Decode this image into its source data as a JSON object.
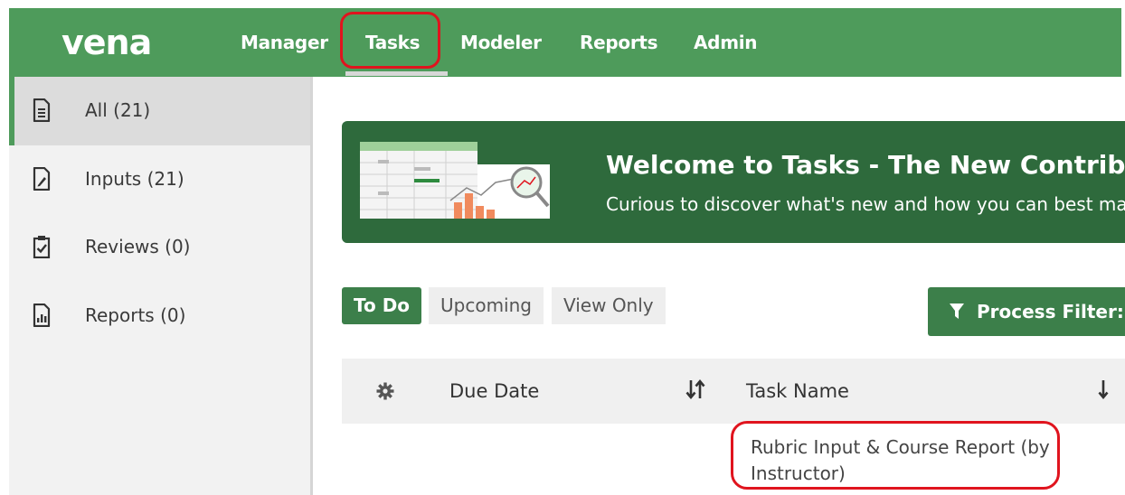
{
  "app": {
    "logo_text": "vena",
    "brand_color": "#4e9b5b",
    "dark_green": "#2e6a3c",
    "highlight_color": "#e0141e"
  },
  "nav": {
    "items": [
      {
        "label": "Manager"
      },
      {
        "label": "Tasks",
        "active": true
      },
      {
        "label": "Modeler"
      },
      {
        "label": "Reports"
      },
      {
        "label": "Admin"
      }
    ]
  },
  "sidebar": {
    "items": [
      {
        "label": "All (21)",
        "icon": "document-icon",
        "active": true
      },
      {
        "label": "Inputs (21)",
        "icon": "edit-document-icon"
      },
      {
        "label": "Reviews (0)",
        "icon": "clipboard-check-icon"
      },
      {
        "label": "Reports (0)",
        "icon": "report-chart-icon"
      }
    ]
  },
  "banner": {
    "title": "Welcome to Tasks - The New Contributo",
    "subtitle": "Curious to discover what's new and how you can best mar"
  },
  "tabs": [
    {
      "label": "To Do",
      "active": true
    },
    {
      "label": "Upcoming"
    },
    {
      "label": "View Only"
    }
  ],
  "filter": {
    "label": "Process Filter: A",
    "icon": "filter-icon"
  },
  "table": {
    "columns": [
      {
        "label": "Due Date",
        "sort_icon": "sort-updown-icon"
      },
      {
        "label": "Task Name",
        "sort_icon": "sort-down-icon"
      }
    ],
    "rows": [
      {
        "task_name": "Rubric Input & Course Report (by Instructor)"
      }
    ]
  }
}
